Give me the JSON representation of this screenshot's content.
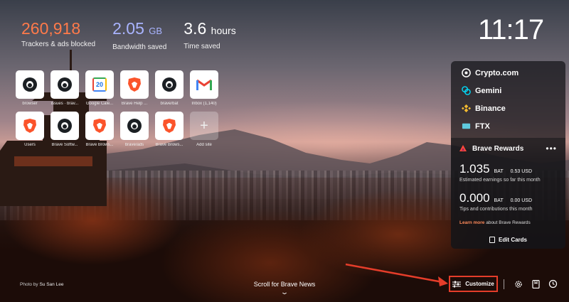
{
  "stats": [
    {
      "value": "260,918",
      "unit": "",
      "label": "Trackers & ads blocked"
    },
    {
      "value": "2.05",
      "unit": "GB",
      "label": "Bandwidth saved"
    },
    {
      "value": "3.6",
      "unit": "hours",
      "label": "Time saved"
    }
  ],
  "clock": "11:17",
  "top_sites": [
    {
      "name": "browser",
      "icon": "github-icon"
    },
    {
      "name": "issues · brav...",
      "icon": "github-icon"
    },
    {
      "name": "Google Cale...",
      "icon": "calendar-icon",
      "badge": "20"
    },
    {
      "name": "Brave Help ...",
      "icon": "brave-icon"
    },
    {
      "name": "brave/bat",
      "icon": "github-icon"
    },
    {
      "name": "Inbox (1,140)",
      "icon": "gmail-icon"
    },
    {
      "name": "Users",
      "icon": "brave-icon"
    },
    {
      "name": "Brave Softw...",
      "icon": "github-icon"
    },
    {
      "name": "Brave Brows...",
      "icon": "brave-icon"
    },
    {
      "name": "brave/ads",
      "icon": "github-icon"
    },
    {
      "name": "Brave Brows...",
      "icon": "brave-icon"
    },
    {
      "name": "Add site",
      "icon": "plus-icon"
    }
  ],
  "exchanges": [
    {
      "name": "Crypto.com",
      "color": "#ffffff"
    },
    {
      "name": "Gemini",
      "color": "#00dcfa"
    },
    {
      "name": "Binance",
      "color": "#f3ba2f"
    },
    {
      "name": "FTX",
      "color": "#5fcade"
    }
  ],
  "rewards": {
    "title": "Brave Rewards",
    "menu": "•••",
    "estimated": {
      "amount": "1.035",
      "currency": "BAT",
      "usd": "0.53 USD",
      "desc": "Estimated earnings so far this month"
    },
    "tips": {
      "amount": "0.000",
      "currency": "BAT",
      "usd": "0.00 USD",
      "desc": "Tips and contributions this month"
    },
    "learn_link": "Learn more",
    "learn_rest": " about Brave Rewards"
  },
  "edit_cards": "Edit Cards",
  "photo": {
    "prefix": "Photo by ",
    "author": "Su San Lee"
  },
  "scroll_news": "Scroll for Brave News",
  "customize": "Customize",
  "colors": {
    "accent": "#e53d2a",
    "trackers": "#ff7a4a",
    "bandwidth": "#a9b4ff"
  }
}
